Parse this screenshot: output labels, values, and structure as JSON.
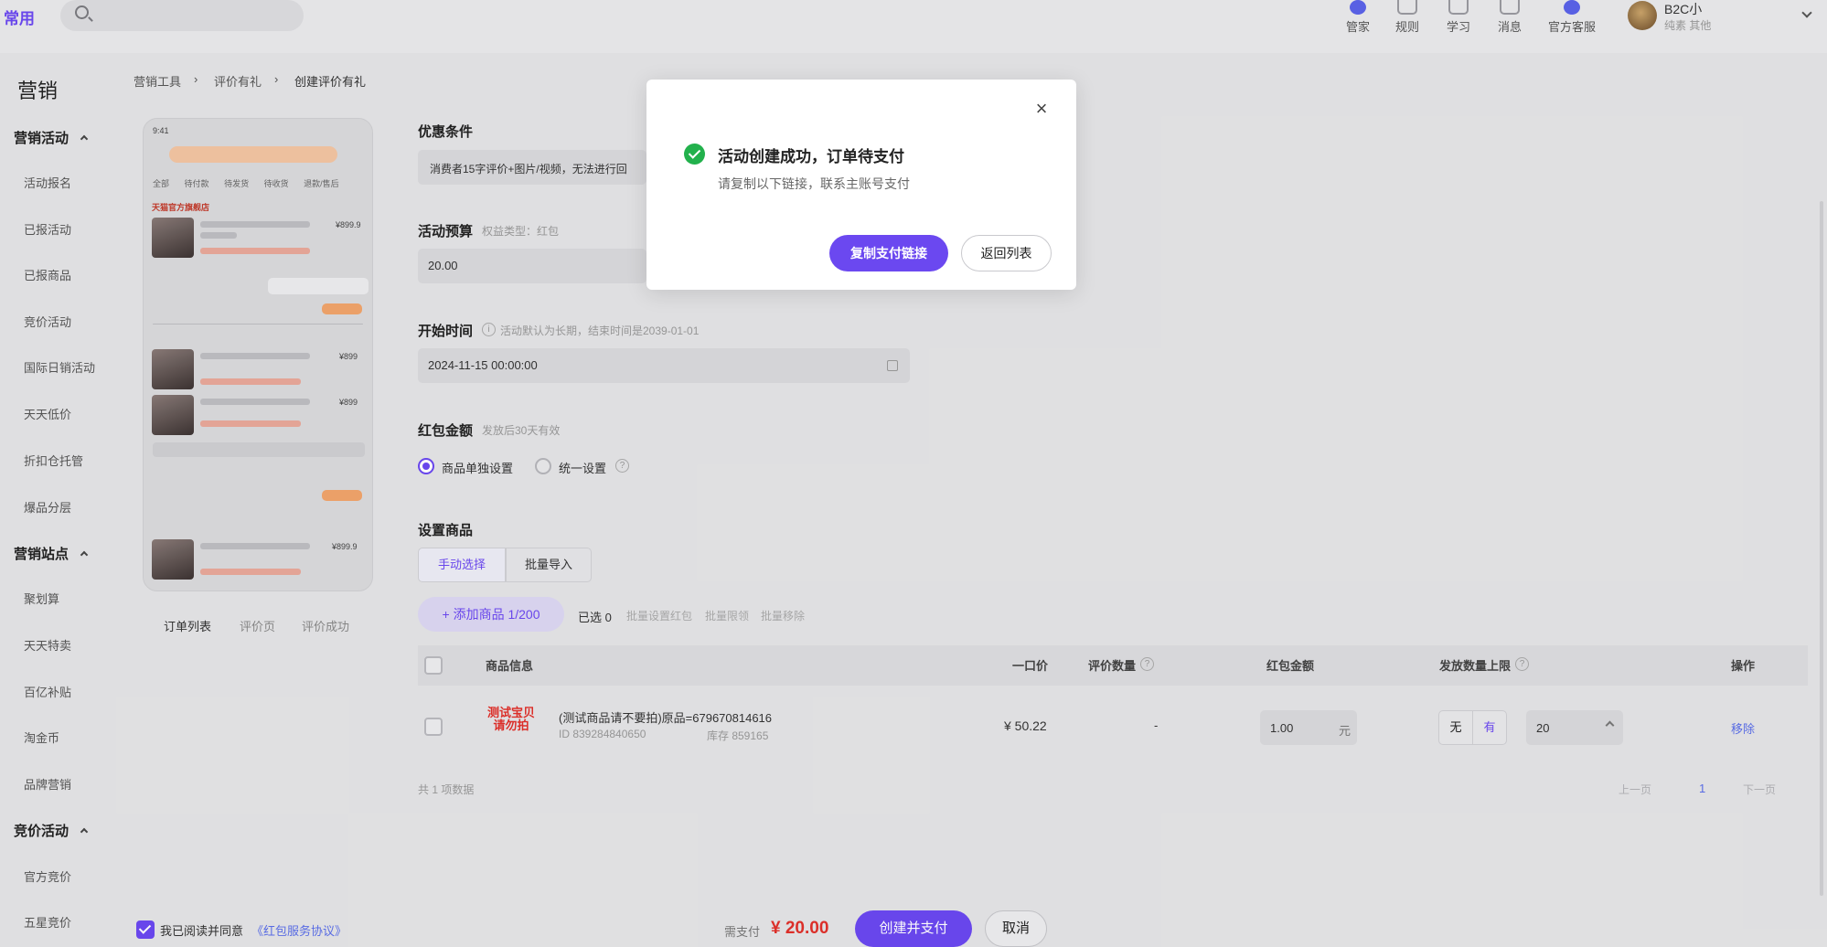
{
  "topbar": {
    "brand": "常用",
    "nav": [
      {
        "label": "管家",
        "icon": "steward-icon"
      },
      {
        "label": "规则",
        "icon": "rules-icon"
      },
      {
        "label": "学习",
        "icon": "learn-icon"
      },
      {
        "label": "消息",
        "icon": "message-icon"
      },
      {
        "label": "官方客服",
        "icon": "customer-service-icon"
      }
    ],
    "user": {
      "name": "B2C小",
      "sub": "纯素  其他"
    }
  },
  "sidebar": {
    "title": "营销",
    "groups": [
      {
        "label": "营销活动",
        "items": [
          "活动报名",
          "已报活动",
          "已报商品",
          "竞价活动",
          "国际日销活动",
          "天天低价",
          "折扣仓托管",
          "爆品分层"
        ]
      },
      {
        "label": "营销站点",
        "items": [
          "聚划算",
          "天天特卖",
          "百亿补贴",
          "淘金币",
          "品牌营销"
        ]
      },
      {
        "label": "竞价活动",
        "items": [
          "官方竞价",
          "五星竞价"
        ]
      }
    ]
  },
  "breadcrumb": [
    "营销工具",
    "评价有礼",
    "创建评价有礼"
  ],
  "preview": {
    "tabs": [
      "订单列表",
      "评价页",
      "评价成功"
    ],
    "phone": {
      "time": "9:41",
      "tabs": [
        "全部",
        "待付款",
        "待发货",
        "待收货",
        "退款/售后"
      ],
      "shop": "天猫官方旗舰店",
      "prices": [
        "¥899.9",
        "¥899",
        "¥899",
        "¥899.9"
      ]
    }
  },
  "form": {
    "condition": {
      "label": "优惠条件",
      "value": "消费者15字评价+图片/视频，无法进行回"
    },
    "budget": {
      "label": "活动预算",
      "hint": "权益类型：红包",
      "value": "20.00"
    },
    "start": {
      "label": "开始时间",
      "hint": "活动默认为长期，结束时间是2039-01-01",
      "value": "2024-11-15 00:00:00"
    },
    "redpacket": {
      "label": "红包金额",
      "hint": "发放后30天有效",
      "options": [
        "商品单独设置",
        "统一设置"
      ],
      "selected": 0
    },
    "goods": {
      "label": "设置商品",
      "tabs": [
        "手动选择",
        "批量导入"
      ],
      "add_button": "+ 添加商品 1/200",
      "selected": "已选 0",
      "batch_actions": [
        "批量设置红包",
        "批量限领",
        "批量移除"
      ]
    }
  },
  "table": {
    "headers": [
      "商品信息",
      "一口价",
      "评价数量",
      "红包金额",
      "发放数量上限",
      "操作"
    ],
    "rows": [
      {
        "thumb": "测试宝贝 请勿拍",
        "title": "(测试商品请不要拍)原品=679670814616",
        "id": "ID 839284840650",
        "stock": "库存 859165",
        "price": "¥ 50.22",
        "reviews": "-",
        "amount": "1.00",
        "unit": "元",
        "limit_options": [
          "无",
          "有"
        ],
        "limit_value": "20",
        "action": "移除"
      }
    ],
    "total": "共 1 项数据",
    "pagination": {
      "prev": "上一页",
      "page": "1",
      "next": "下一页"
    }
  },
  "footer": {
    "agree_text": "我已阅读并同意",
    "agree_link": "《红包服务协议》",
    "pay_label": "需支付",
    "pay_amount": "¥ 20.00",
    "create_button": "创建并支付",
    "cancel_button": "取消"
  },
  "modal": {
    "title": "活动创建成功，订单待支付",
    "subtitle": "请复制以下链接，联系主账号支付",
    "copy_button": "复制支付链接",
    "back_button": "返回列表"
  },
  "colors": {
    "accent": "#6b48f0",
    "success": "#22b14c",
    "price_red": "#e0302a"
  }
}
